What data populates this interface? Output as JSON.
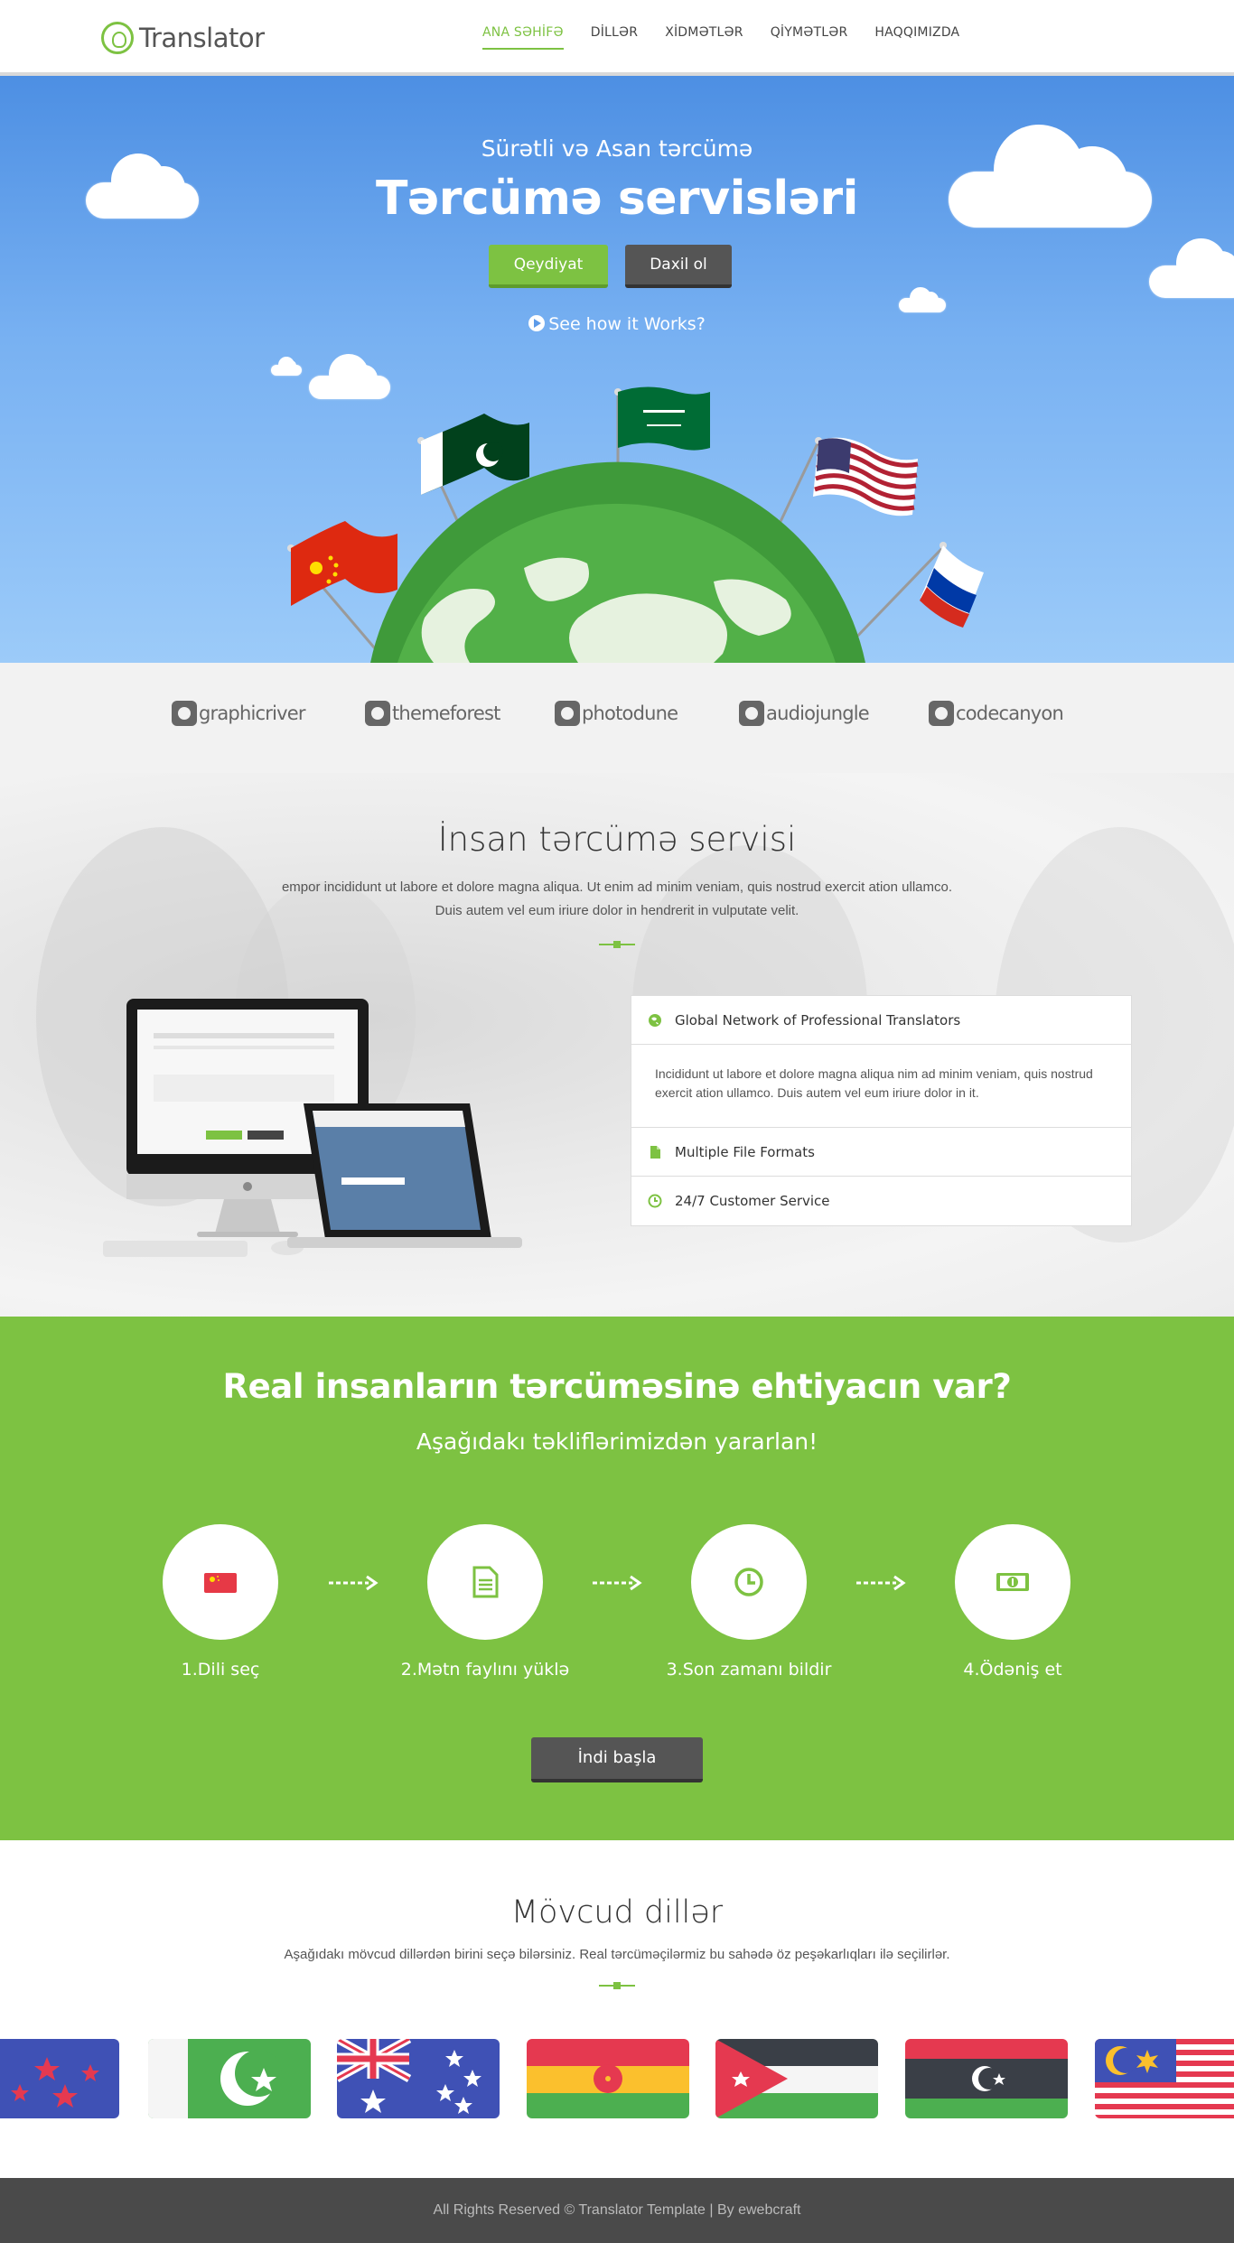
{
  "brand": {
    "name": "Translator"
  },
  "nav": {
    "items": [
      {
        "label": "ANA SƏHİFƏ"
      },
      {
        "label": "DİLLƏR"
      },
      {
        "label": "XİDMƏTLƏR"
      },
      {
        "label": "QİYMƏTLƏR"
      },
      {
        "label": "HAQQIMIZDA"
      }
    ]
  },
  "hero": {
    "subtitle": "Sürətli və Asan tərcümə",
    "title": "Tərcümə servisləri",
    "register_label": "Qeydiyat",
    "login_label": "Daxil ol",
    "how_label": "See how it Works?"
  },
  "partners": [
    {
      "label": "graphicriver"
    },
    {
      "label": "themeforest"
    },
    {
      "label": "photodune"
    },
    {
      "label": "audiojungle"
    },
    {
      "label": "codecanyon"
    }
  ],
  "human": {
    "title": "İnsan tərcümə servisi",
    "text_line1": "empor incididunt ut labore et dolore magna aliqua. Ut enim ad minim veniam, quis nostrud exercit ation ullamco.",
    "text_line2": "Duis autem vel eum iriure dolor in hendrerit in vulputate velit.",
    "accordion": [
      {
        "title": "Global Network of Professional Translators",
        "icon": "globe-icon",
        "body": "Incididunt ut labore et dolore magna aliqua nim ad minim veniam, quis nostrud exercit ation ullamco. Duis autem vel eum iriure dolor in it."
      },
      {
        "title": "Multiple File Formats",
        "icon": "file-icon"
      },
      {
        "title": "24/7 Customer Service",
        "icon": "clock-icon"
      }
    ]
  },
  "cta": {
    "title": "Real insanların tərcüməsinə ehtiyacın var?",
    "subtitle": "Aşağıdakı təkliflərimizdən yararlan!",
    "steps": [
      {
        "label": "1.Dili seç",
        "icon": "flag-icon"
      },
      {
        "label": "2.Mətn faylını yüklə",
        "icon": "document-icon"
      },
      {
        "label": "3.Son zamanı bildir",
        "icon": "clock-icon"
      },
      {
        "label": "4.Ödəniş et",
        "icon": "money-icon"
      }
    ],
    "start_label": "İndi başla"
  },
  "languages": {
    "title": "Mövcud dillər",
    "text": "Aşağıdakı mövcud dillərdən birini seçə bilərsiniz. Real tərcüməçilərmiz bu sahədə öz peşəkarlıqları ilə seçilirlər."
  },
  "footer": {
    "text": "All Rights Reserved © Translator Template | By ewebcraft"
  },
  "colors": {
    "accent": "#7dc242",
    "dark": "#555555",
    "sky": "#5d9be9"
  }
}
